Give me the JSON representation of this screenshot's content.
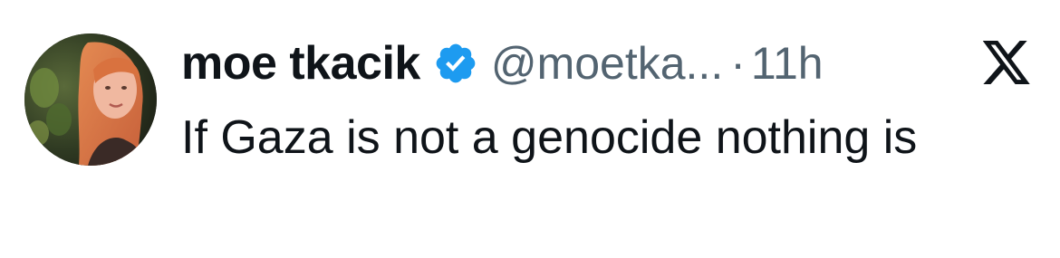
{
  "tweet": {
    "author": {
      "display_name": "moe tkacik",
      "handle": "@moetka...",
      "verified": true,
      "avatar_icon": "profile-photo"
    },
    "separator": "·",
    "time": "11h",
    "platform_icon": "x-logo-icon",
    "text": "If Gaza is not a genocide nothing is"
  },
  "colors": {
    "text_primary": "#0f1419",
    "text_secondary": "#536471",
    "verified_blue": "#1d9bf0",
    "background": "#ffffff"
  }
}
